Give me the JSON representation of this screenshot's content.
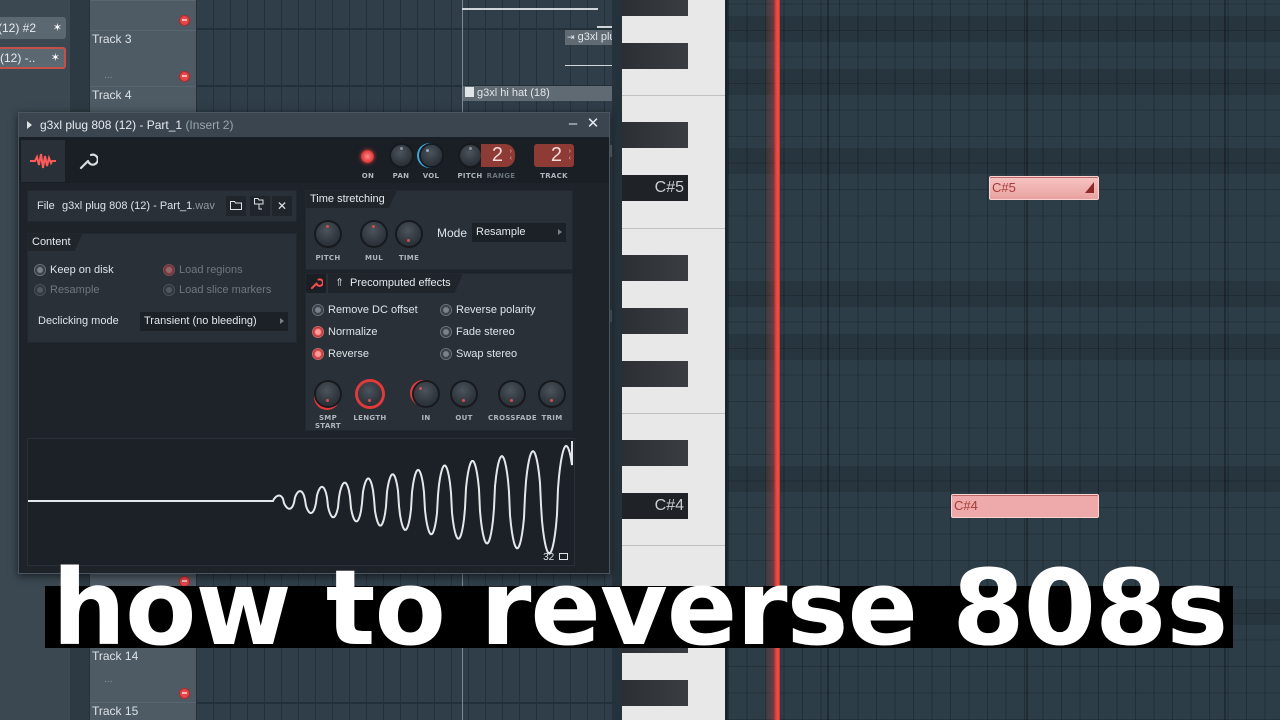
{
  "playlist": {
    "channel_buttons": [
      {
        "label": "(12) #2",
        "selected": false
      },
      {
        "label": "(12) -..",
        "selected": true
      }
    ],
    "tracks": [
      {
        "name": "Track 3",
        "more": "..."
      },
      {
        "name": "Track 4",
        "more": "..."
      },
      {
        "name": "Track 14",
        "more": "..."
      },
      {
        "name": "Track 15",
        "more": "..."
      }
    ],
    "clips": [
      {
        "label": "g3xl plu",
        "icon": "audio-clip-icon"
      },
      {
        "label": "g3xl hi hat (18)",
        "icon": "pattern-clip-icon"
      }
    ]
  },
  "channel_window": {
    "title": "g3xl plug 808 (12) - Part_1",
    "insert": "(Insert 2)",
    "minimize_label": "–",
    "close_label": "✕",
    "tabs": [
      {
        "name": "wave-tab",
        "icon": "waveform-icon",
        "active": true
      },
      {
        "name": "settings-tab",
        "icon": "wrench-icon",
        "active": false
      }
    ],
    "controls": {
      "on_label": "ON",
      "on": true,
      "pan_label": "PAN",
      "vol_label": "VOL",
      "pitch_label": "PITCH",
      "range_label": "RANGE",
      "range_value": "2",
      "track_label": "TRACK",
      "track_value": "2"
    },
    "file": {
      "label": "File",
      "name": "g3xl plug 808 (12) - Part_1",
      "ext": ".wav",
      "open_icon": "folder-icon",
      "locate_icon": "browse-icon",
      "clear_icon": "close-icon"
    },
    "content": {
      "title": "Content",
      "options": [
        {
          "label": "Keep on disk",
          "checked": false,
          "enabled": true
        },
        {
          "label": "Resample",
          "checked": false,
          "enabled": false
        },
        {
          "label": "Load regions",
          "checked": true,
          "enabled": false
        },
        {
          "label": "Load slice markers",
          "checked": false,
          "enabled": false
        }
      ],
      "declicking_label": "Declicking mode",
      "declicking_value": "Transient (no bleeding)"
    },
    "time_stretching": {
      "title": "Time stretching",
      "knobs": [
        "PITCH",
        "MUL",
        "TIME"
      ],
      "mode_label": "Mode",
      "mode_value": "Resample"
    },
    "precomputed": {
      "title": "Precomputed effects",
      "options": [
        {
          "label": "Remove DC offset",
          "checked": false
        },
        {
          "label": "Normalize",
          "checked": true
        },
        {
          "label": "Reverse",
          "checked": true
        },
        {
          "label": "Reverse polarity",
          "checked": false
        },
        {
          "label": "Fade stereo",
          "checked": false
        },
        {
          "label": "Swap stereo",
          "checked": false
        }
      ],
      "knobs": [
        "SMP START",
        "LENGTH",
        "IN",
        "OUT",
        "CROSSFADE",
        "TRIM"
      ]
    },
    "waveform": {
      "zoom_value": "32",
      "reversed": true
    }
  },
  "piano_roll": {
    "key_labels": [
      "C#5",
      "C#4"
    ],
    "notes": [
      {
        "label": "C#5",
        "slide": true
      },
      {
        "label": "C#4",
        "slide": false
      }
    ]
  },
  "overlay": {
    "title": "how to reverse 808s"
  },
  "colors": {
    "accent_red": "#e33c3c",
    "note_fill": "#eeaaaa",
    "display_red": "#8e3b36"
  }
}
